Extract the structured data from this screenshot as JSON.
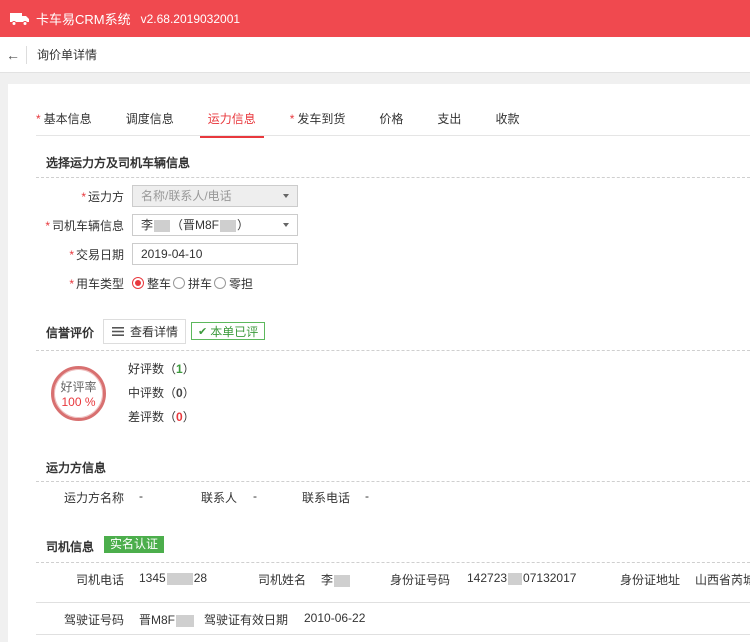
{
  "app": {
    "title": "卡车易CRM系统",
    "version": "v2.68.2019032001",
    "brand_color": "#f0494f"
  },
  "breadcrumb": {
    "title": "询价单详情"
  },
  "tabs": [
    {
      "label": "基本信息",
      "required": true
    },
    {
      "label": "调度信息",
      "required": false
    },
    {
      "label": "运力信息",
      "required": false,
      "active": true
    },
    {
      "label": "发车到货",
      "required": true
    },
    {
      "label": "价格",
      "required": false
    },
    {
      "label": "支出",
      "required": false
    },
    {
      "label": "收款",
      "required": false
    }
  ],
  "form": {
    "section_title": "选择运力方及司机车辆信息",
    "carrier": {
      "label": "运力方",
      "placeholder": "名称/联系人/电话"
    },
    "vehicle": {
      "label": "司机车辆信息",
      "value_prefix": "李",
      "value_mid": "（晋M8F",
      "value_suffix": "）"
    },
    "trade_date": {
      "label": "交易日期",
      "value": "2019-04-10"
    },
    "vehicle_type": {
      "label": "用车类型",
      "options": [
        "整车",
        "拼车",
        "零担"
      ],
      "selected": "整车"
    }
  },
  "reputation": {
    "title": "信誉评价",
    "detail_button": "查看详情",
    "rated_badge": "本单已评",
    "rate_label": "好评率",
    "rate_value": "100 %",
    "good_label": "好评数（",
    "good_count": "1",
    "good_close": "）",
    "mid_label": "中评数（",
    "mid_count": "0",
    "mid_close": "）",
    "bad_label": "差评数（",
    "bad_count": "0",
    "bad_close": "）"
  },
  "carrier_info": {
    "title": "运力方信息",
    "name_label": "运力方名称",
    "name_value": "-",
    "contact_label": "联系人",
    "contact_value": "-",
    "phone_label": "联系电话",
    "phone_value": "-"
  },
  "driver_info": {
    "title": "司机信息",
    "badge": "实名认证",
    "phone_label": "司机电话",
    "phone_prefix": "1345",
    "phone_suffix": "28",
    "name_label": "司机姓名",
    "name_value": "李",
    "id_label": "身份证号码",
    "id_prefix": "142723",
    "id_suffix": "07132017",
    "address_label": "身份证地址",
    "address_value": "山西省芮城",
    "license_label": "驾驶证号码",
    "license_value": "晋M8F",
    "license_valid_label": "驾驶证有效日期",
    "license_valid_value": "2010-06-22"
  }
}
